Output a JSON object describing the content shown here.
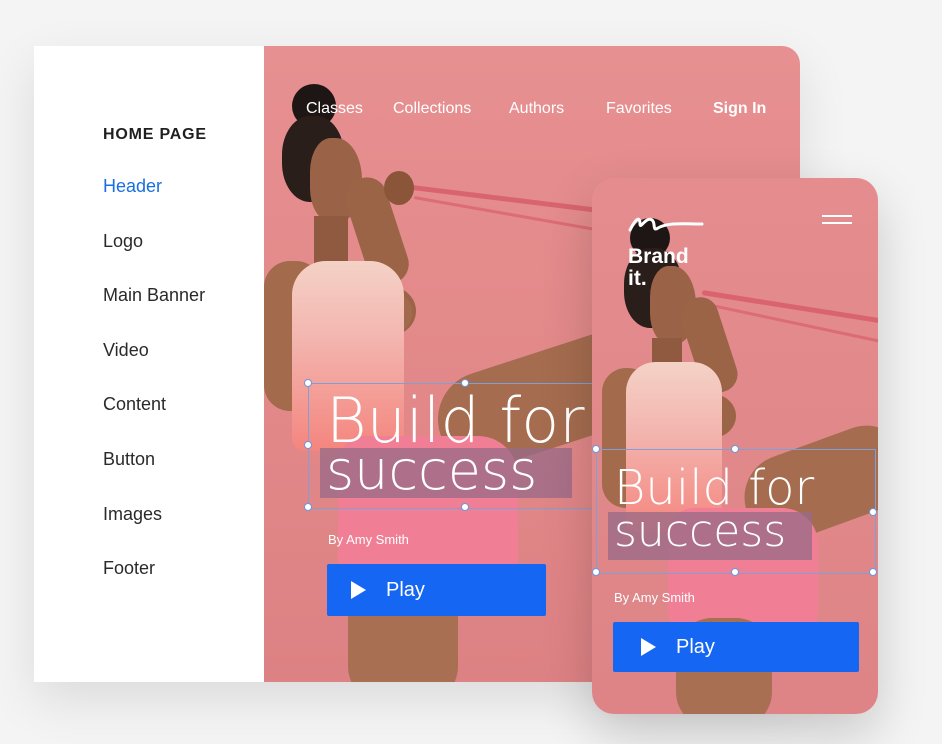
{
  "sidebar": {
    "heading": "HOME PAGE",
    "items": [
      {
        "label": "Header",
        "active": true
      },
      {
        "label": "Logo"
      },
      {
        "label": "Main Banner"
      },
      {
        "label": "Video"
      },
      {
        "label": "Content"
      },
      {
        "label": "Button"
      },
      {
        "label": "Images"
      },
      {
        "label": "Footer"
      }
    ]
  },
  "nav": {
    "items": [
      "Classes",
      "Collections",
      "Authors",
      "Favorites"
    ],
    "signin": "Sign In"
  },
  "hero": {
    "headline_line1": "Build for",
    "headline_line2": "success",
    "byline": "By Amy Smith",
    "play_label": "Play"
  },
  "mobile": {
    "brand_line1": "Brand",
    "brand_line2": "it.",
    "headline_line1": "Build for",
    "headline_line2": "success",
    "byline": "By Amy Smith",
    "play_label": "Play"
  },
  "colors": {
    "accent": "#1566f2",
    "active_link": "#1a6fe0",
    "hero_bg": "#e28889"
  }
}
